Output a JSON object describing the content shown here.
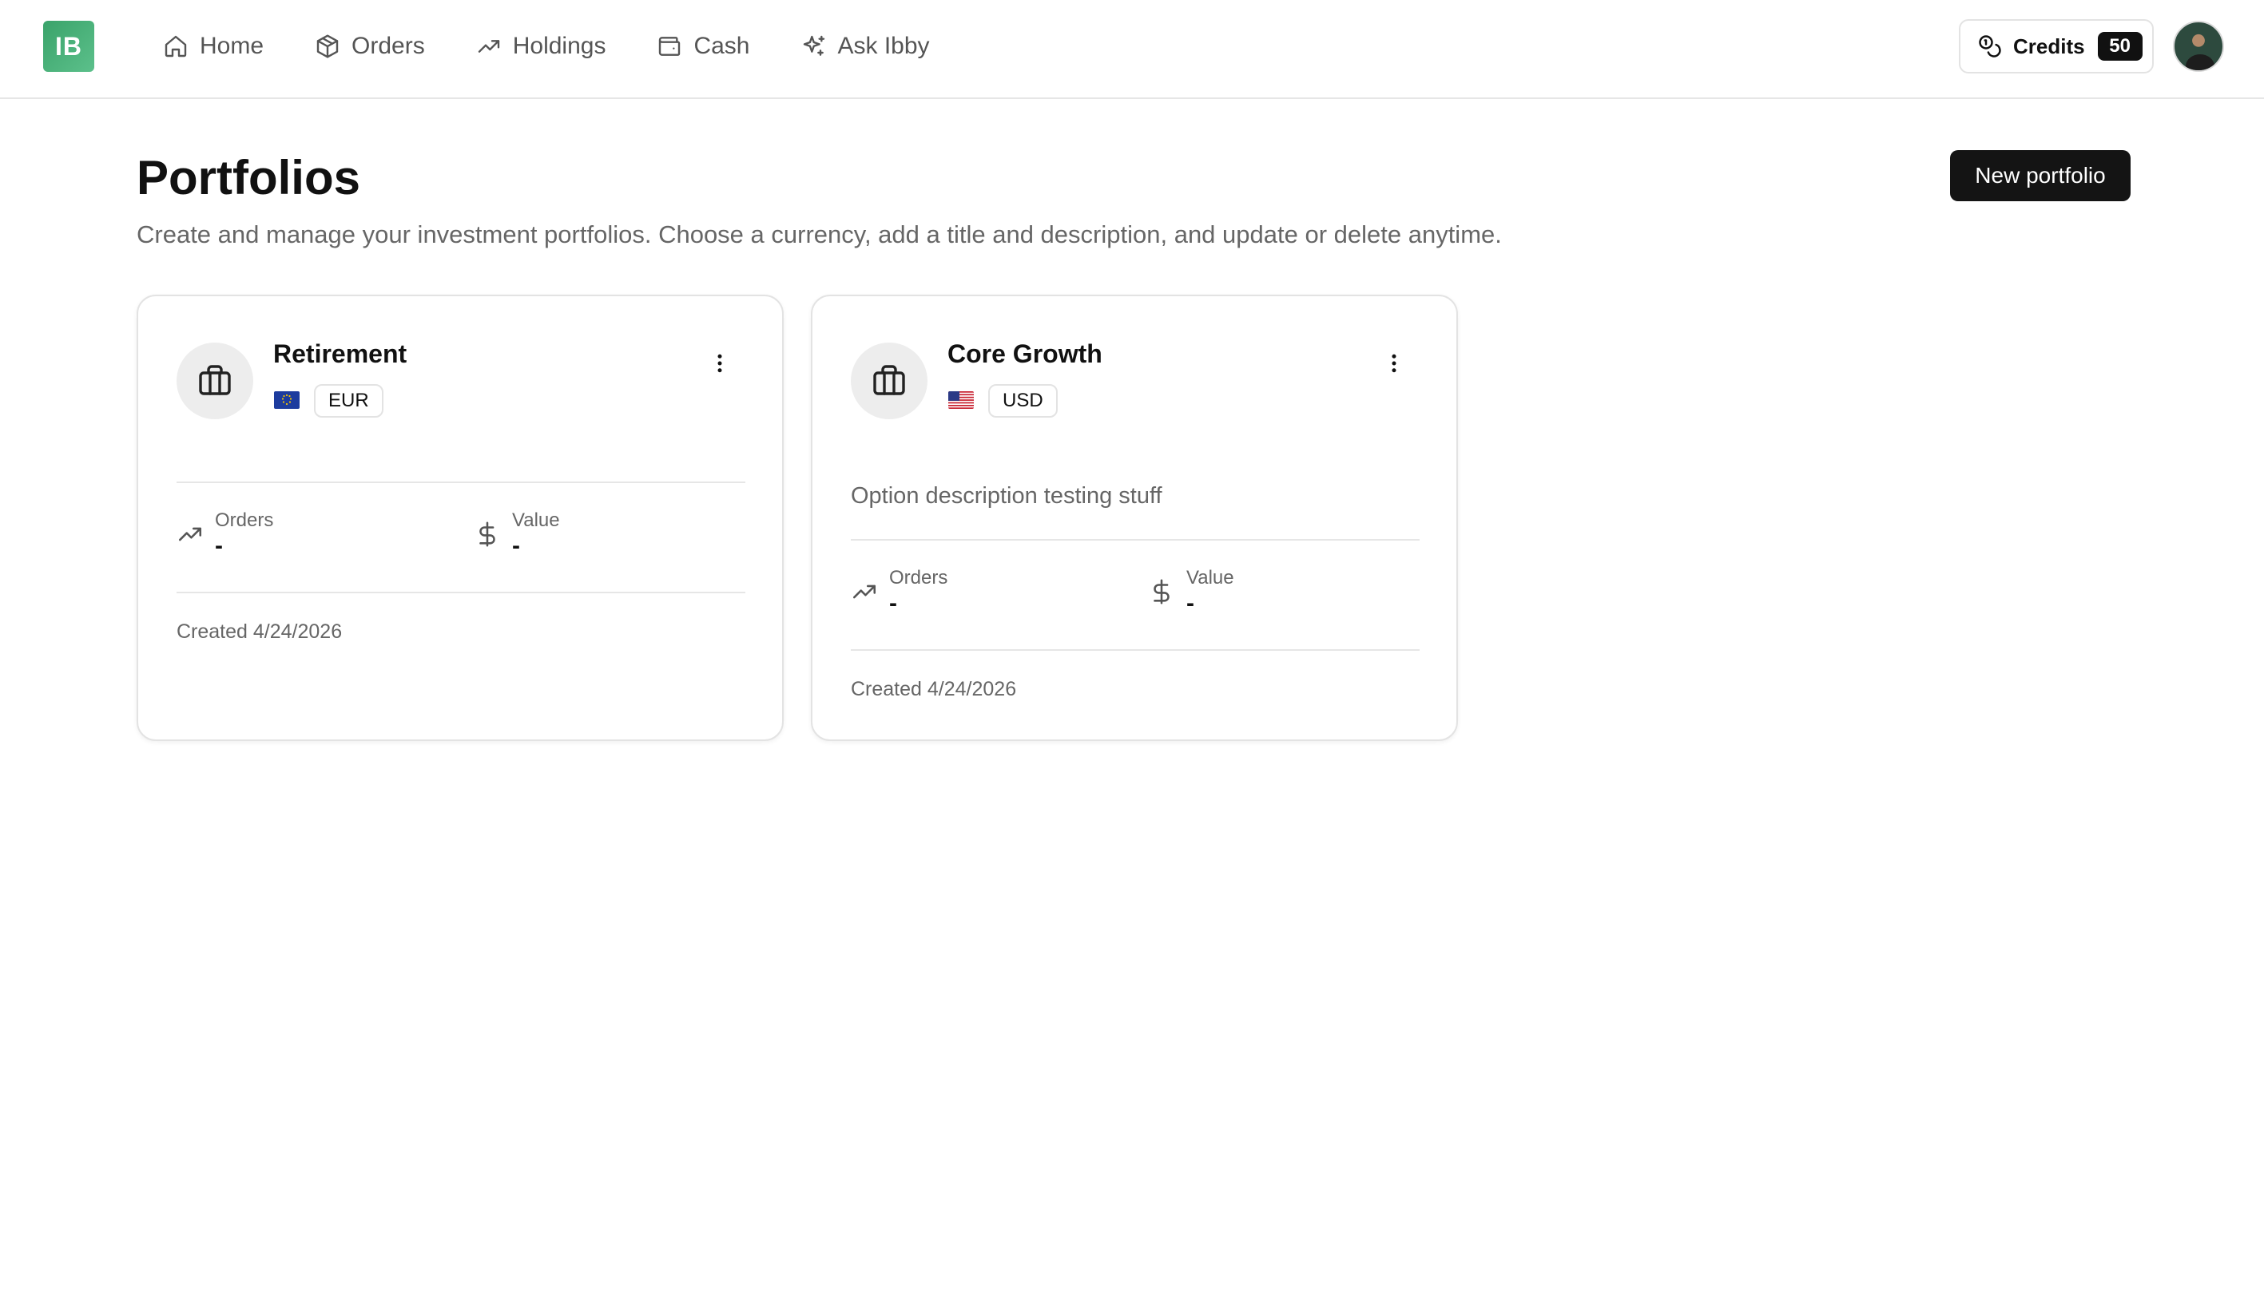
{
  "brand": {
    "logo_text": "IB",
    "accent": "#3aa36a"
  },
  "nav": {
    "items": [
      {
        "label": "Home",
        "icon": "home-icon"
      },
      {
        "label": "Orders",
        "icon": "box-icon"
      },
      {
        "label": "Holdings",
        "icon": "trending-up-icon"
      },
      {
        "label": "Cash",
        "icon": "wallet-icon"
      },
      {
        "label": "Ask Ibby",
        "icon": "sparkle-icon"
      }
    ]
  },
  "credits": {
    "label": "Credits",
    "count": "50",
    "icon": "coins-icon"
  },
  "page": {
    "title": "Portfolios",
    "subtitle": "Create and manage your investment portfolios. Choose a currency, add a title and description, and update or delete anytime.",
    "new_button": "New portfolio"
  },
  "portfolios": [
    {
      "name": "Retirement",
      "currency": "EUR",
      "flag": "eu-flag-icon",
      "description": "",
      "orders_label": "Orders",
      "orders_value": "-",
      "value_label": "Value",
      "value_value": "-",
      "created": "Created 4/24/2026"
    },
    {
      "name": "Core Growth",
      "currency": "USD",
      "flag": "us-flag-icon",
      "description": "Option description testing stuff",
      "orders_label": "Orders",
      "orders_value": "-",
      "value_label": "Value",
      "value_value": "-",
      "created": "Created 4/24/2026"
    }
  ]
}
